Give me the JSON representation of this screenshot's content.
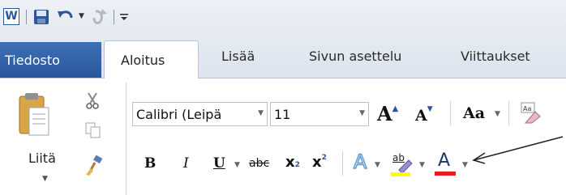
{
  "qat": {
    "app_icon_letter": "W",
    "items": [
      "word-icon",
      "save-icon",
      "undo-icon",
      "redo-icon",
      "customize-qat-icon"
    ]
  },
  "tabs": {
    "file": "Tiedosto",
    "active": "Aloitus",
    "items": [
      "Lisää",
      "Sivun asettelu",
      "Viittaukset"
    ]
  },
  "clipboard": {
    "paste_label": "Liitä",
    "icons": [
      "paste-icon",
      "cut-icon",
      "copy-icon",
      "format-painter-icon"
    ]
  },
  "font": {
    "font_name": "Calibri (Leipä",
    "font_size": "11",
    "grow_label": "A",
    "shrink_label": "A",
    "change_case_label": "Aa",
    "bold_label": "B",
    "italic_label": "I",
    "underline_label": "U",
    "strike_label": "abc",
    "subscript_label": "x",
    "subscript_mark": "2",
    "superscript_label": "x",
    "superscript_mark": "2",
    "text_effects_label": "A",
    "highlight_label": "ab",
    "font_color_label": "A"
  },
  "colors": {
    "file_tab": "#2b579a",
    "highlight": "#ffff00",
    "font_color_bar": "#e81c24",
    "text_effect": "#5b9bd5"
  }
}
